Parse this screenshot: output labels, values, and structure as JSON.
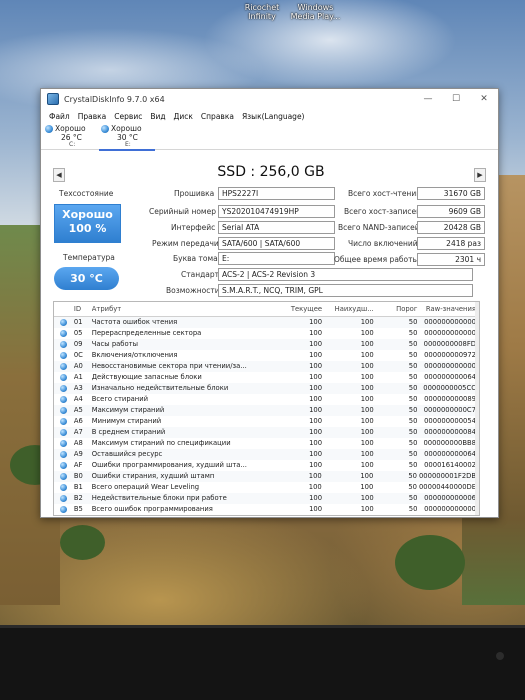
{
  "desktop_icons": [
    {
      "line1": "Ricochet",
      "line2": "Infinity"
    },
    {
      "line1": "Windows",
      "line2": "Media Play..."
    }
  ],
  "window": {
    "title": "CrystalDiskInfo 9.7.0 x64",
    "buttons": {
      "minimize": "—",
      "maximize": "☐",
      "close": "✕"
    }
  },
  "menu": [
    "Файл",
    "Правка",
    "Сервис",
    "Вид",
    "Диск",
    "Справка",
    "Язык(Language)"
  ],
  "drives": [
    {
      "status": "Хорошо",
      "temp": "26 °C",
      "letter": "C:"
    },
    {
      "status": "Хорошо",
      "temp": "30 °C",
      "letter": "E:"
    }
  ],
  "nav": {
    "prev": "◀",
    "next": "▶"
  },
  "disk_title": "SSD : 256,0 GB",
  "health": {
    "label": "Техсостояние",
    "status": "Хорошо",
    "percent": "100 %",
    "temp_label": "Температура",
    "temp": "30 °C"
  },
  "info": {
    "firmware_label": "Прошивка",
    "firmware": "HPS2227I",
    "serial_label": "Серийный номер",
    "serial": "YS202010474919HP",
    "interface_label": "Интерфейс",
    "interface": "Serial ATA",
    "transfer_label": "Режим передачи",
    "transfer": "SATA/600 | SATA/600",
    "volume_label": "Буква тома",
    "volume": "E:",
    "standard_label": "Стандарт",
    "standard": "ACS-2 | ACS-2 Revision 3",
    "features_label": "Возможности",
    "features": "S.M.A.R.T., NCQ, TRIM, GPL",
    "host_reads_label": "Всего хост-чтений",
    "host_reads": "31670 GB",
    "host_writes_label": "Всего хост-записей",
    "host_writes": "9609 GB",
    "nand_writes_label": "Всего NAND-записей",
    "nand_writes": "20428 GB",
    "power_on_count_label": "Число включений",
    "power_on_count": "2418 раз",
    "power_on_hours_label": "Общее время работы",
    "power_on_hours": "2301 ч"
  },
  "table": {
    "headers": {
      "id": "ID",
      "name": "Атрибут",
      "current": "Текущее",
      "worst": "Наихудш...",
      "threshold": "Порог",
      "raw": "Raw-значения"
    },
    "rows": [
      {
        "id": "01",
        "name": "Частота ошибок чтения",
        "current": "100",
        "worst": "100",
        "threshold": "50",
        "raw": "000000000000"
      },
      {
        "id": "05",
        "name": "Перераспределенные сектора",
        "current": "100",
        "worst": "100",
        "threshold": "50",
        "raw": "000000000000"
      },
      {
        "id": "09",
        "name": "Часы работы",
        "current": "100",
        "worst": "100",
        "threshold": "50",
        "raw": "0000000008FD"
      },
      {
        "id": "0C",
        "name": "Включения/отключения",
        "current": "100",
        "worst": "100",
        "threshold": "50",
        "raw": "000000000972"
      },
      {
        "id": "A0",
        "name": "Невосстановимые сектора при чтении/за...",
        "current": "100",
        "worst": "100",
        "threshold": "50",
        "raw": "000000000000"
      },
      {
        "id": "A1",
        "name": "Действующие запасные блоки",
        "current": "100",
        "worst": "100",
        "threshold": "50",
        "raw": "000000000064"
      },
      {
        "id": "A3",
        "name": "Изначально недействительные блоки",
        "current": "100",
        "worst": "100",
        "threshold": "50",
        "raw": "0000000005CC"
      },
      {
        "id": "A4",
        "name": "Всего стираний",
        "current": "100",
        "worst": "100",
        "threshold": "50",
        "raw": "000000000089"
      },
      {
        "id": "A5",
        "name": "Максимум стираний",
        "current": "100",
        "worst": "100",
        "threshold": "50",
        "raw": "0000000000C7"
      },
      {
        "id": "A6",
        "name": "Минимум стираний",
        "current": "100",
        "worst": "100",
        "threshold": "50",
        "raw": "000000000054"
      },
      {
        "id": "A7",
        "name": "В среднем стираний",
        "current": "100",
        "worst": "100",
        "threshold": "50",
        "raw": "000000000084"
      },
      {
        "id": "A8",
        "name": "Максимум стираний по спецификации",
        "current": "100",
        "worst": "100",
        "threshold": "50",
        "raw": "000000000BB8"
      },
      {
        "id": "A9",
        "name": "Оставшийся ресурс",
        "current": "100",
        "worst": "100",
        "threshold": "50",
        "raw": "000000000064"
      },
      {
        "id": "AF",
        "name": "Ошибки программирования, худший шта...",
        "current": "100",
        "worst": "100",
        "threshold": "50",
        "raw": "000016140002"
      },
      {
        "id": "B0",
        "name": "Ошибки стирания, худший штамп",
        "current": "100",
        "worst": "100",
        "threshold": "50",
        "raw": "000000001F2DB"
      },
      {
        "id": "B1",
        "name": "Всего операций Wear Leveling",
        "current": "100",
        "worst": "100",
        "threshold": "50",
        "raw": "00000440000DE"
      },
      {
        "id": "B2",
        "name": "Недействительные блоки при работе",
        "current": "100",
        "worst": "100",
        "threshold": "50",
        "raw": "000000000006"
      },
      {
        "id": "B5",
        "name": "Всего ошибок программирования",
        "current": "100",
        "worst": "100",
        "threshold": "50",
        "raw": "000000000000"
      }
    ]
  },
  "colors": {
    "accent": "#2f7fd0",
    "status_dot": "#3c8fd8"
  }
}
